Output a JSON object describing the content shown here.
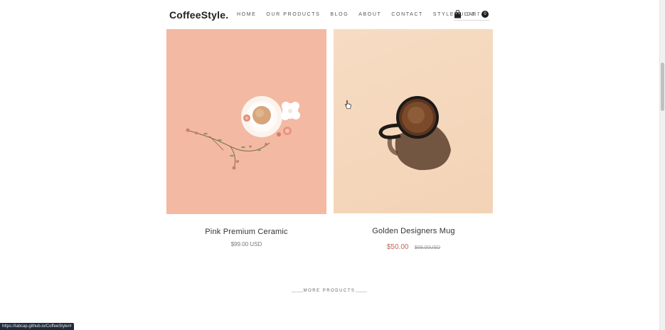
{
  "header": {
    "logo": "CoffeeStyle.",
    "nav": [
      "HOME",
      "OUR PRODUCTS",
      "BLOG",
      "ABOUT",
      "CONTACT",
      "STYLEGUIDE"
    ],
    "cart_label": "CART",
    "cart_count": "0"
  },
  "products": [
    {
      "name": "Pink Premium Ceramic",
      "price": "$99.00 USD"
    },
    {
      "name": "Golden Designers Mug",
      "price": "$50.00",
      "old_price": "$69.00USD"
    }
  ],
  "more_products": "MORE PRODUCTS",
  "status_url": "https://labcap.github.io/CoffeeStyle/#",
  "colors": {
    "sale_price": "#c0665a",
    "pink_bg": "#f3b9a3",
    "peach_bg": "#f4d6ba"
  }
}
